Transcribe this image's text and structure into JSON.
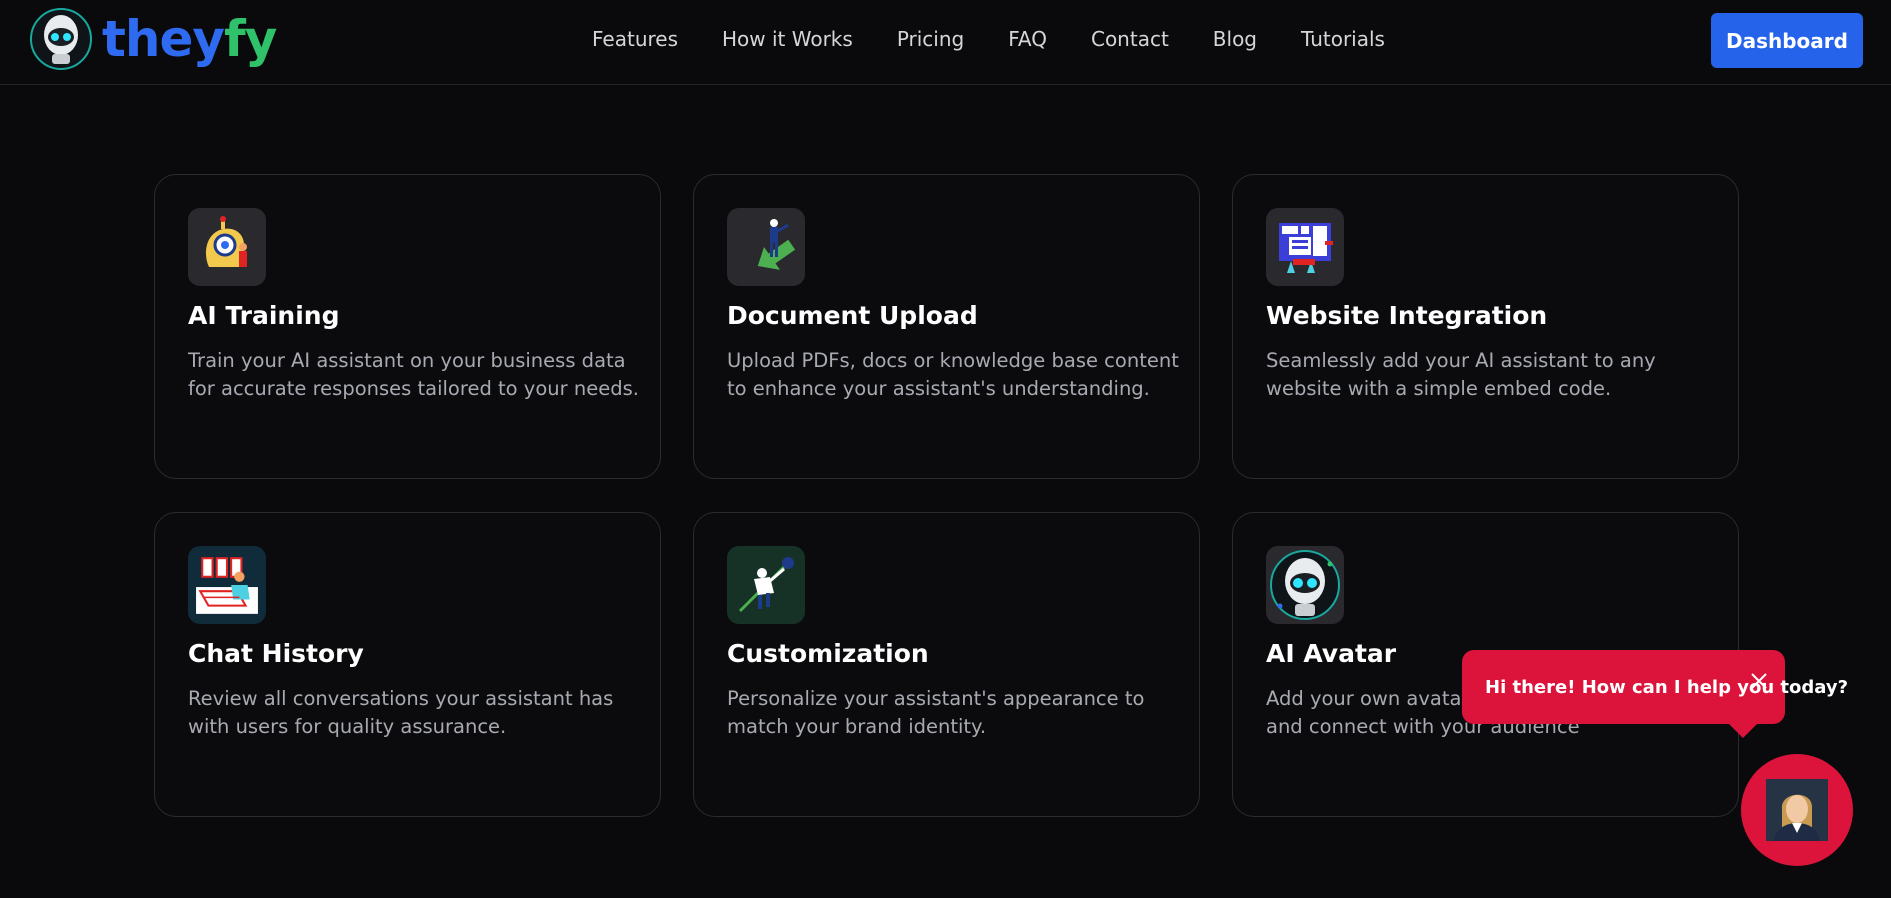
{
  "header": {
    "logo": {
      "part1": "they",
      "part2": "fy",
      "icon": "robot-head-icon"
    },
    "nav": [
      "Features",
      "How it Works",
      "Pricing",
      "FAQ",
      "Contact",
      "Blog",
      "Tutorials"
    ],
    "dashboard_label": "Dashboard"
  },
  "features": [
    {
      "title": "AI Training",
      "description": "Train your AI assistant on your business data for accurate responses tailored to your needs.",
      "icon": "ai-training-icon"
    },
    {
      "title": "Document Upload",
      "description": "Upload PDFs, docs or knowledge base content to enhance your assistant's understanding.",
      "icon": "document-upload-icon"
    },
    {
      "title": "Website Integration",
      "description": "Seamlessly add your AI assistant to any website with a simple embed code.",
      "icon": "website-integration-icon"
    },
    {
      "title": "Chat History",
      "description": "Review all conversations your assistant has with users for quality assurance.",
      "icon": "chat-history-icon"
    },
    {
      "title": "Customization",
      "description": "Personalize your assistant's appearance to match your brand identity.",
      "icon": "customization-icon"
    },
    {
      "title": "AI Avatar",
      "description": "Add your own avatar to improve engagement, and connect with your audience",
      "icon": "robot-avatar-icon"
    }
  ],
  "chat": {
    "message": "Hi there! How can I help you today?",
    "close_icon": "close-icon",
    "avatar_icon": "assistant-avatar-icon"
  },
  "colors": {
    "background": "#0a0a0c",
    "primary": "#2563eb",
    "logo_blue": "#2e6bf0",
    "logo_green": "#2fc26a",
    "chat_red": "#dc143c"
  }
}
